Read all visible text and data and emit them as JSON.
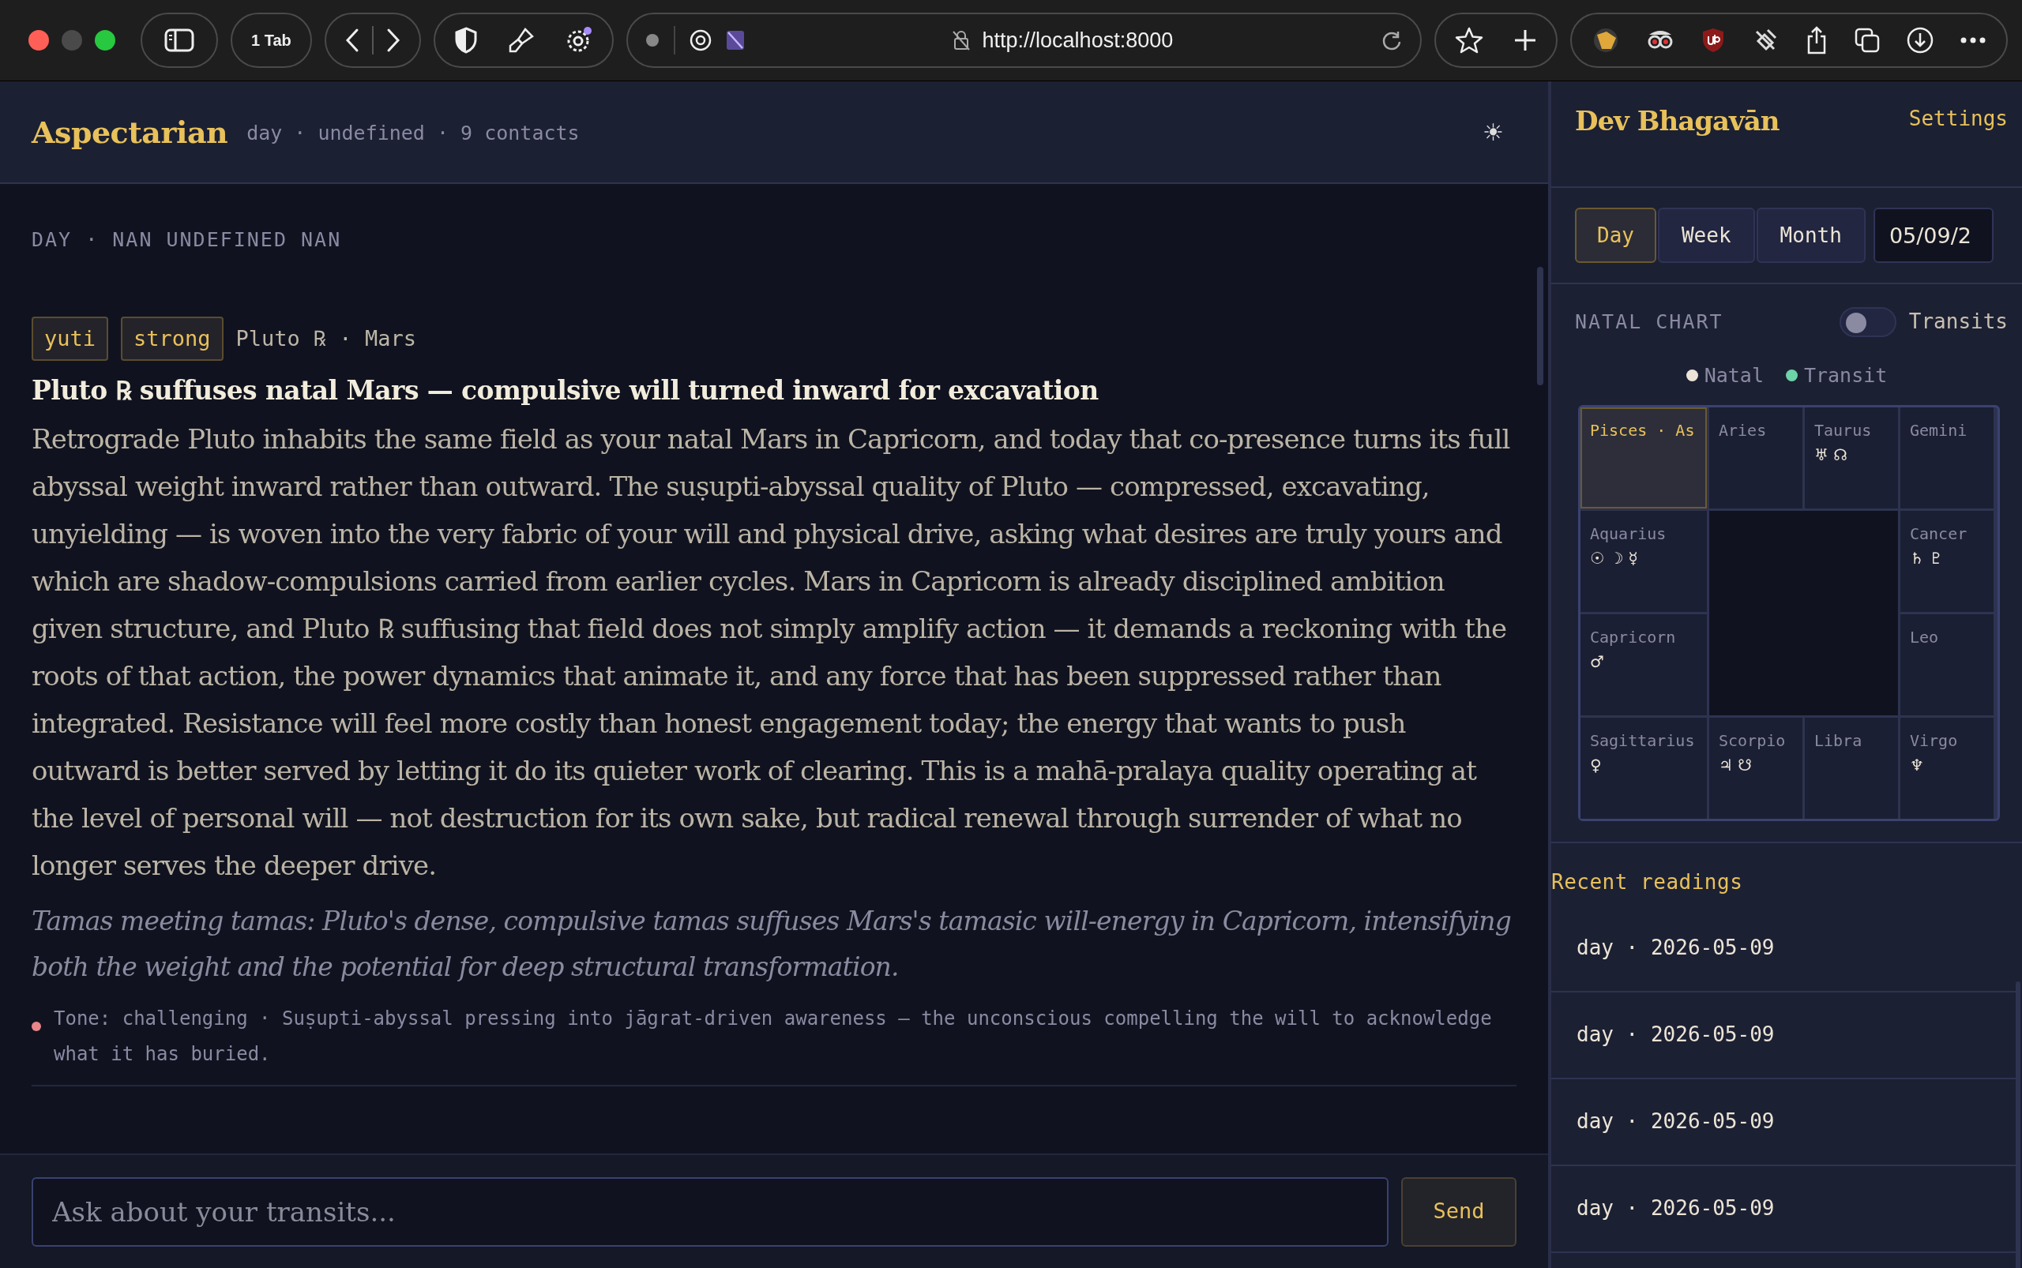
{
  "browser": {
    "tab_button": "1 Tab",
    "url": "http://localhost:8000"
  },
  "header": {
    "brand": "Aspectarian",
    "meta": "day · undefined · 9 contacts",
    "theme_toggle": "☀"
  },
  "reading": {
    "heading": "DAY · NAN UNDEFINED NAN",
    "tags": [
      "yuti",
      "strong"
    ],
    "bodies": "Pluto ℞ · Mars",
    "title": "Pluto ℞ suffuses natal Mars — compulsive will turned inward for excavation",
    "body": "Retrograde Pluto inhabits the same field as your natal Mars in Capricorn, and today that co-presence turns its full abyssal weight inward rather than outward. The suṣupti-abyssal quality of Pluto — compressed, excavating, unyielding — is woven into the very fabric of your will and physical drive, asking what desires are truly yours and which are shadow-compulsions carried from earlier cycles. Mars in Capricorn is already disciplined ambition given structure, and Pluto ℞ suffusing that field does not simply amplify action — it demands a reckoning with the roots of that action, the power dynamics that animate it, and any force that has been suppressed rather than integrated. Resistance will feel more costly than honest engagement today; the energy that wants to push outward is better served by letting it do its quieter work of clearing. This is a mahā-pralaya quality operating at the level of personal will — not destruction for its own sake, but radical renewal through surrender of what no longer serves the deeper drive.",
    "note": "Tamas meeting tamas: Pluto's dense, compulsive tamas suffuses Mars's tamasic will-energy in Capricorn, intensifying both the weight and the potential for deep structural transformation.",
    "tone": {
      "text": "Tone: challenging · Suṣupti-abyssal pressing into jāgrat-driven awareness — the unconscious compelling the will to acknowledge what it has buried.",
      "color": "#e8868a"
    }
  },
  "composer": {
    "placeholder": "Ask about your transits...",
    "send": "Send"
  },
  "sidebar": {
    "name": "Dev Bhagavān",
    "settings": "Settings",
    "periods": [
      {
        "label": "Day",
        "selected": true
      },
      {
        "label": "Week",
        "selected": false
      },
      {
        "label": "Month",
        "selected": false
      }
    ],
    "date": "05/09/2",
    "chart_label": "NATAL CHART",
    "transits_toggle": {
      "label": "Transits",
      "on": false
    },
    "legend": [
      {
        "label": "Natal",
        "color": "#ece4d6"
      },
      {
        "label": "Transit",
        "color": "#6dd3a8"
      }
    ],
    "signs": [
      {
        "name": "Pisces · As",
        "ascendant": true
      },
      {
        "name": "Aries",
        "ascendant": false
      },
      {
        "name": "Taurus",
        "planets": "♅ ☊",
        "ascendant": false
      },
      {
        "name": "Gemini",
        "ascendant": false
      },
      {
        "name": "Aquarius",
        "planets": "☉ ☽ ☿",
        "ascendant": false
      },
      {
        "name": "Cancer",
        "planets": "♄ ♇",
        "ascendant": false
      },
      {
        "name": "Capricorn",
        "planets": "♂",
        "ascendant": false
      },
      {
        "name": "Leo",
        "ascendant": false
      },
      {
        "name": "Sagittarius",
        "planets": "♀",
        "ascendant": false
      },
      {
        "name": "Scorpio",
        "planets": "♃ ☋",
        "ascendant": false
      },
      {
        "name": "Libra",
        "ascendant": false
      },
      {
        "name": "Virgo",
        "planets": "♆",
        "ascendant": false
      }
    ],
    "recent_title": "Recent readings",
    "recent": [
      "day · 2026-05-09",
      "day · 2026-05-09",
      "day · 2026-05-09",
      "day · 2026-05-09"
    ]
  }
}
